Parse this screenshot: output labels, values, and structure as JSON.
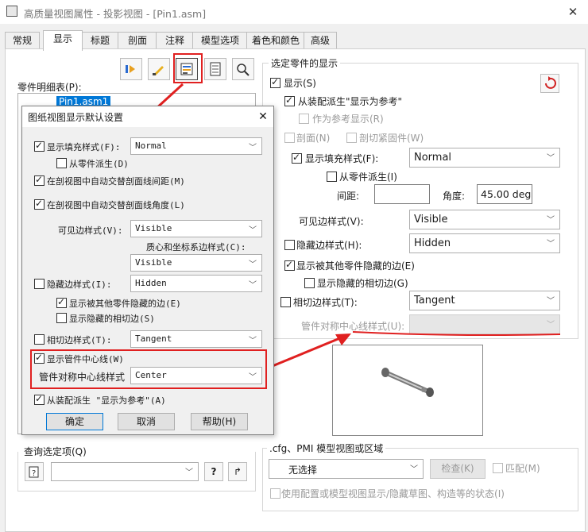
{
  "window": {
    "title": "高质量视图属性 - 投影视图 - [Pin1.asm]",
    "close": "✕"
  },
  "tabs": [
    "常规",
    "显示",
    "标题",
    "剖面",
    "注释",
    "模型选项",
    "着色和颜色",
    "高级"
  ],
  "left": {
    "parts_list_label": "零件明细表(P):",
    "tree_item": "Pin1.asm1",
    "query_group": "查询选定项(Q)"
  },
  "right": {
    "group_title": "选定零件的显示",
    "show": "显示(S)",
    "from_assembly_ref": "从装配派生\"显示为参考\"",
    "show_as_ref": "作为参考显示(R)",
    "section": "剖面(N)",
    "section_fasteners": "剖切紧固件(W)",
    "show_fill": "显示填充样式(F):",
    "fill_value": "Normal",
    "from_part": "从零件派生(I)",
    "spacing": "间距:",
    "angle": "角度:",
    "angle_value": "45.00 deg",
    "visible_edge": "可见边样式(V):",
    "visible_value": "Visible",
    "hidden_edge": "隐藏边样式(H):",
    "hidden_value": "Hidden",
    "show_hidden_by_others": "显示被其他零件隐藏的边(E)",
    "show_hidden_tangent": "显示隐藏的相切边(G)",
    "tangent_edge": "相切边样式(T):",
    "tangent_value": "Tangent",
    "pipe_centerline": "管件对称中心线样式(U):"
  },
  "bottom": {
    "group_title": ".cfg、PMI 模型视图或区域",
    "no_selection": "无选择",
    "check": "检查(K)",
    "match": "匹配(M)",
    "use_config": "使用配置或模型视图显示/隐藏草图、构造等的状态(I)"
  },
  "dialog": {
    "title": "图纸视图显示默认设置",
    "close": "✕",
    "show_fill": "显示填充样式(F):",
    "fill_value": "Normal",
    "from_part": "从零件派生(D)",
    "auto_spacing": "在剖视图中自动交替剖面线间距(M)",
    "auto_angle": "在剖视图中自动交替剖面线角度(L)",
    "visible_edge": "可见边样式(V):",
    "visible_value": "Visible",
    "centroid_style": "质心和坐标系边样式(C):",
    "centroid_value": "Visible",
    "hidden_edge": "隐藏边样式(I):",
    "hidden_value": "Hidden",
    "show_hidden_by_others": "显示被其他零件隐藏的边(E)",
    "show_hidden_tangent": "显示隐藏的相切边(S)",
    "tangent_edge": "相切边样式(T):",
    "tangent_value": "Tangent",
    "show_pipe_centerline": "显示管件中心线(W)",
    "pipe_centerline_style": "管件对称中心线样式",
    "pipe_centerline_value": "Center",
    "from_assembly_ref": "从装配派生 \"显示为参考\"(A)",
    "ok": "确定",
    "cancel": "取消",
    "help": "帮助(H)"
  },
  "colors": {
    "highlight": "#e02020"
  }
}
